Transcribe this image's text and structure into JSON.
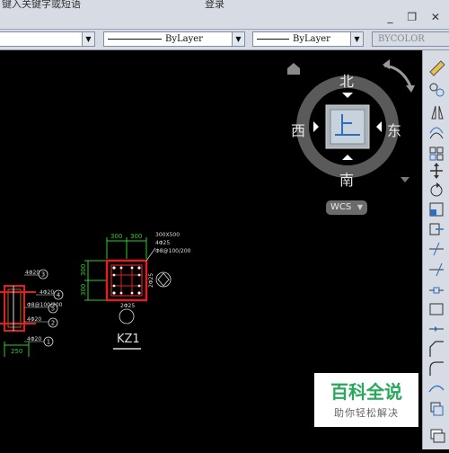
{
  "header": {
    "search_text": "键入关键字或短语",
    "login_label": "登录",
    "window_controls": "_ ❐ ✕"
  },
  "properties": {
    "color_value": "ByLayer",
    "linetype_value": "ByLayer",
    "lineweight_value": "BYCOLOR"
  },
  "viewcube": {
    "north": "北",
    "south": "南",
    "east": "东",
    "west": "西",
    "top_face": "上",
    "wcs_label": "WCS"
  },
  "drawing": {
    "left_detail": {
      "bars": [
        "4Φ20",
        "4Φ20",
        "Φ8@100/200",
        "4Φ20",
        "4Φ20"
      ],
      "markers": [
        "3",
        "4",
        "5",
        "2",
        "1"
      ],
      "dim_bottom": "250"
    },
    "kz1": {
      "dim_top_left": "300",
      "dim_top_right": "300",
      "dim_left_top": "300",
      "dim_left_bottom": "300",
      "note_size": "300X500",
      "note_bars": "4Φ25",
      "note_stirrup": "Φ8@100/200",
      "side_bars": "2Φ25",
      "bottom_bars": "2Φ25",
      "title": "KZ1"
    }
  },
  "watermark": {
    "title": "百科全说",
    "subtitle": "助你轻松解决"
  },
  "colors": {
    "accent_green": "#27a85a",
    "canvas": "#000000",
    "dimension": "#2ecc2e",
    "rebar": "#e02020"
  }
}
